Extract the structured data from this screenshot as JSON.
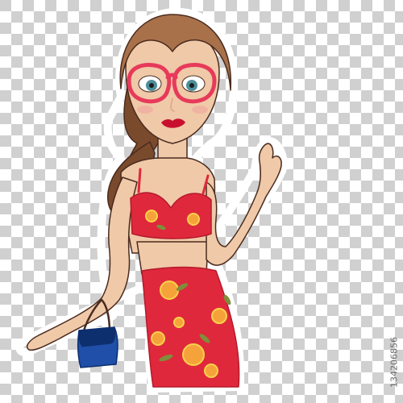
{
  "image": {
    "background": "transparency-checkerboard",
    "subject": "fashion-woman-illustration"
  },
  "watermark": {
    "stock_id": "134206856"
  },
  "colors": {
    "checker_light": "#ffffff",
    "checker_dark": "#d0d0d0",
    "hair": "#a9714a",
    "hair_dark": "#7a4a2c",
    "skin": "#f0c9a8",
    "skin_shadow": "#d9a884",
    "dress_red": "#e0283c",
    "dress_dark": "#b31a2c",
    "flower_orange": "#f6a23a",
    "flower_yellow": "#f7d24a",
    "leaf_green": "#7d8f3a",
    "glasses": "#e73a5a",
    "eyes": "#4e8f9a",
    "lips": "#c8102e",
    "bag_blue": "#1f4fa8",
    "bag_dark": "#0e2f6e",
    "outline": "#4a2b1f",
    "sticker_border": "#ffffff"
  }
}
